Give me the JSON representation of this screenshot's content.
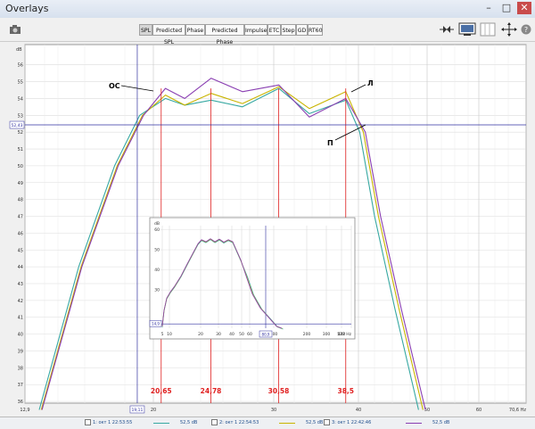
{
  "window": {
    "title": "Overlays",
    "min": "–",
    "max": "□",
    "close": "✕"
  },
  "tabs": [
    {
      "label": "SPL",
      "active": true
    },
    {
      "label": "Predicted SPL",
      "active": false
    },
    {
      "label": "Phase",
      "active": false
    },
    {
      "label": "Predicted Phase",
      "active": false
    },
    {
      "label": "Impulse",
      "active": false
    },
    {
      "label": "ETC",
      "active": false
    },
    {
      "label": "Step",
      "active": false
    },
    {
      "label": "GD",
      "active": false
    },
    {
      "label": "RT60",
      "active": false
    }
  ],
  "toolbar_icons": [
    "camera-icon",
    "controls-icon",
    "display-icon",
    "grid-icon",
    "arrows-icon",
    "help-icon"
  ],
  "colors": {
    "green": "#37a8a2",
    "yellow": "#c9b400",
    "purple": "#8a3fb2",
    "red": "#e02020",
    "blue": "#3030a0"
  },
  "main_plot": {
    "y_unit": "dB",
    "y_ticks": [
      "56",
      "55",
      "54",
      "53",
      "52",
      "51",
      "50",
      "49",
      "48",
      "47",
      "46",
      "45",
      "44",
      "43",
      "42",
      "41",
      "40",
      "39",
      "38",
      "37",
      "36"
    ],
    "y_cursor_label": "52,43",
    "x_ticks": [
      "12,9",
      "20",
      "30",
      "40",
      "50",
      "60",
      "70,6 Hz"
    ],
    "x_cursor_label": "19,11",
    "markers": [
      "20,65",
      "24,78",
      "30,58",
      "38,5"
    ],
    "annotations": {
      "oc": "ОС",
      "l": "Л",
      "p": "П"
    }
  },
  "inset_plot": {
    "y_unit": "dB",
    "y_ticks": [
      "60",
      "50",
      "40",
      "30"
    ],
    "y_cursor_label": "14,9",
    "x_ticks": [
      "5",
      "10",
      "20",
      "30",
      "40",
      "50",
      "60",
      "100",
      "200",
      "300",
      "400",
      "522 Hz"
    ],
    "x_cursor_label": "80,9"
  },
  "legend": [
    {
      "label": "1: окт 1 22:53:55",
      "value": "52,5 dB",
      "color": "#37a8a2"
    },
    {
      "label": "2: окт 1 22:54:53",
      "value": "52,5 dB",
      "color": "#c9b400"
    },
    {
      "label": "3: окт 1 22:42:46",
      "value": "52,5 dB",
      "color": "#8a3fb2"
    }
  ]
}
